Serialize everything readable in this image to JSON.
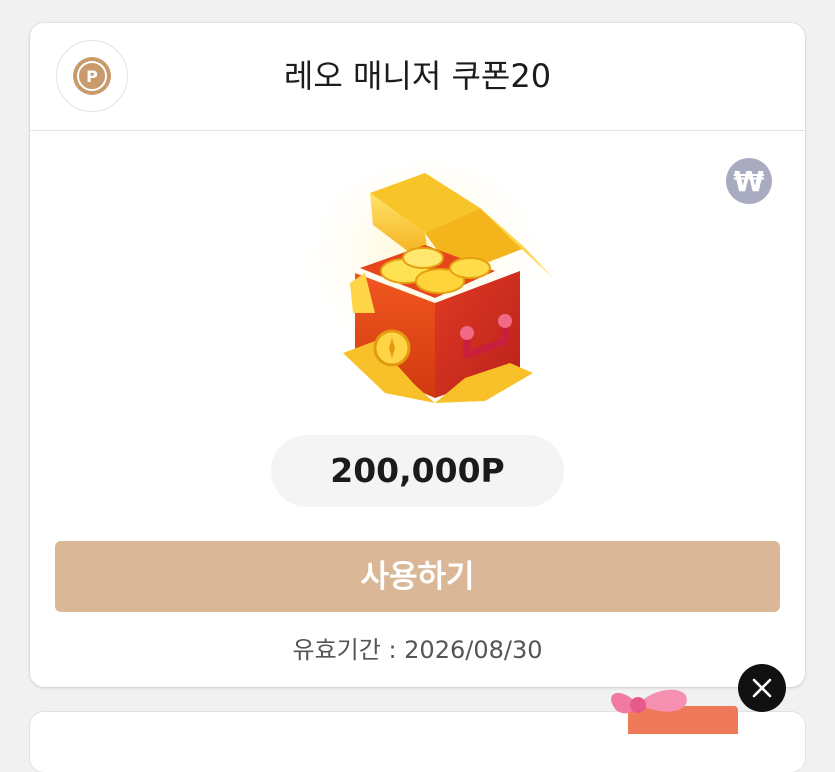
{
  "coupon": {
    "title": "레오 매니저 쿠폰20",
    "point_badge_letter": "P",
    "currency_badge_symbol": "₩",
    "amount": "200,000P",
    "use_button_label": "사용하기",
    "expiry_text": "유효기간 : 2026/08/30"
  },
  "icons": {
    "point": "point-coin-icon",
    "currency": "won-icon",
    "reward": "treasure-chest-icon",
    "close": "close-icon",
    "gift": "gift-box-icon"
  },
  "colors": {
    "use_button": "#d9b797",
    "point_badge": "#c99a6b",
    "currency_badge": "#a9abc0",
    "close_button": "#111111"
  }
}
